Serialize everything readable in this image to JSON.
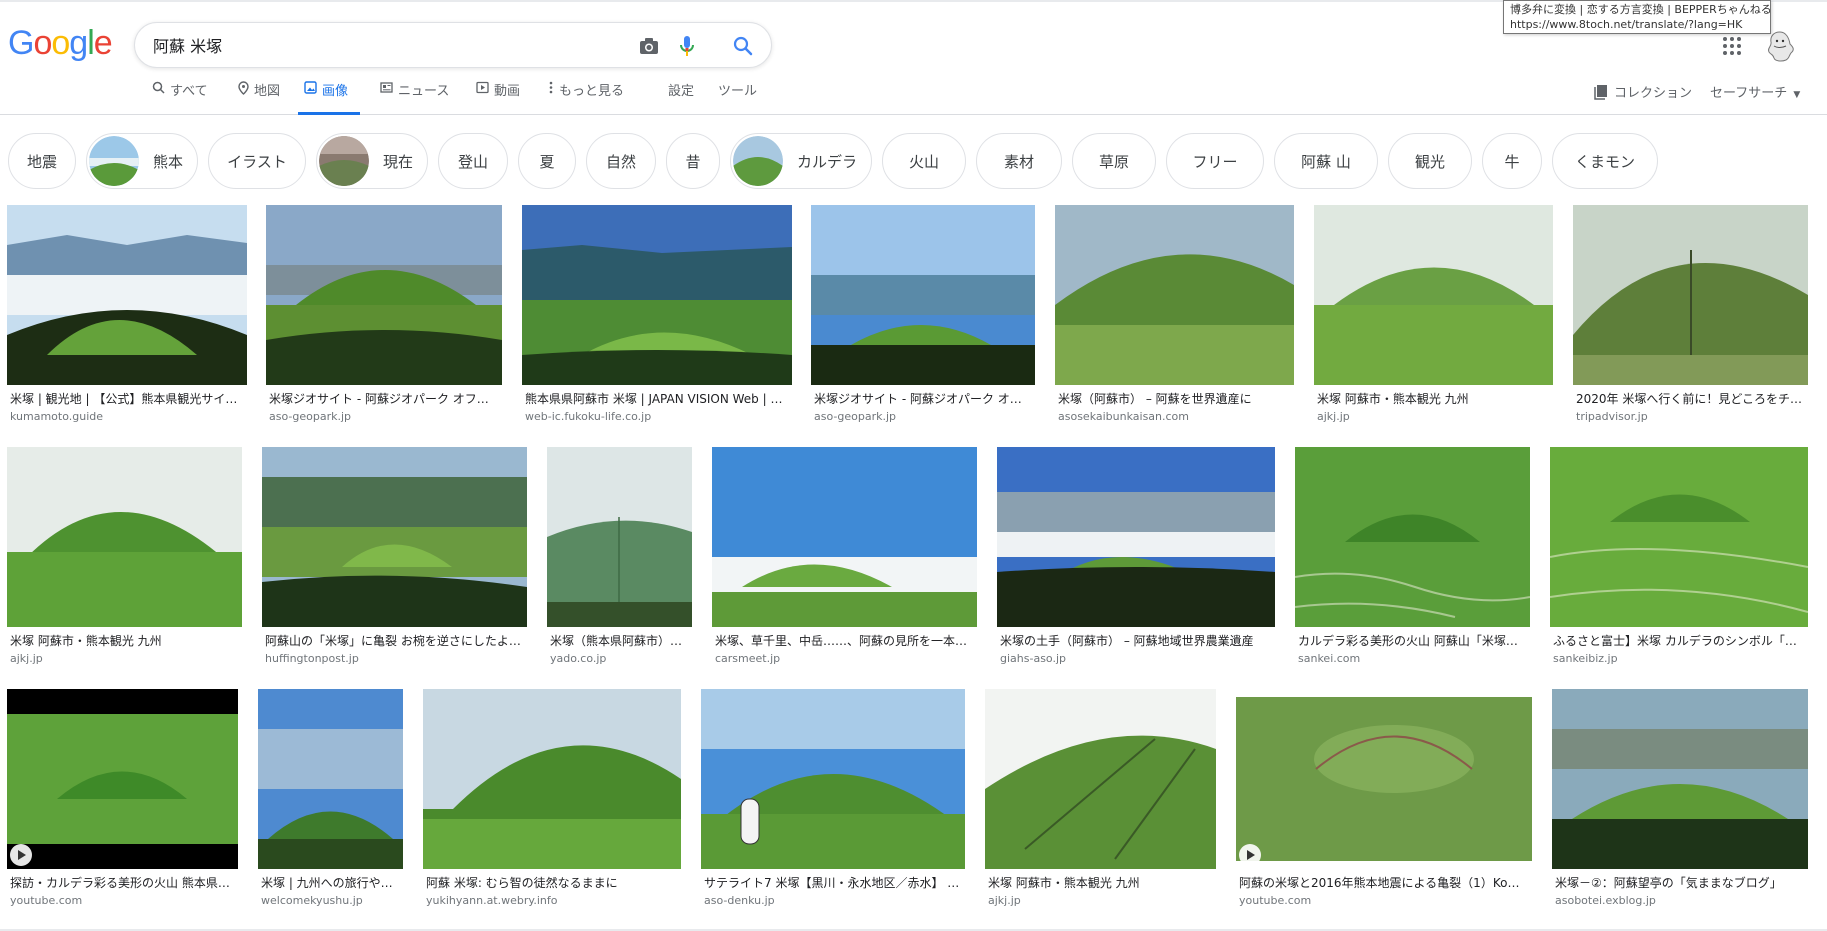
{
  "logo": {
    "letters": [
      "G",
      "o",
      "o",
      "g",
      "l",
      "e"
    ]
  },
  "search": {
    "query": "阿蘇 米塚"
  },
  "tooltip": {
    "line1": "博多弁に変換 | 恋する方言変換 | BEPPERちゃんねる",
    "line2": "https://www.8toch.net/translate/?lang=HK"
  },
  "nav": {
    "all": "すべて",
    "maps": "地図",
    "images": "画像",
    "news": "ニュース",
    "videos": "動画",
    "more": "もっと見る",
    "settings": "設定",
    "tools": "ツール"
  },
  "collections": "コレクション",
  "safesearch": "セーフサーチ",
  "chips": [
    "地震",
    "熊本",
    "イラスト",
    "現在",
    "登山",
    "夏",
    "自然",
    "昔",
    "カルデラ",
    "火山",
    "素材",
    "草原",
    "フリー",
    "阿蘇 山",
    "観光",
    "牛",
    "くまモン"
  ],
  "results": [
    {
      "title": "米塚 | 観光地 | 【公式】熊本県観光サイ…",
      "source": "kumamoto.guide"
    },
    {
      "title": "米塚ジオサイト - 阿蘇ジオパーク オフ…",
      "source": "aso-geopark.jp"
    },
    {
      "title": "熊本県県阿蘇市 米塚 | JAPAN VISION Web | フ…",
      "source": "web-ic.fukoku-life.co.jp"
    },
    {
      "title": "米塚ジオサイト - 阿蘇ジオパーク オ…",
      "source": "aso-geopark.jp"
    },
    {
      "title": "米塚（阿蘇市） – 阿蘇を世界遺産に",
      "source": "asosekaibunkaisan.com"
    },
    {
      "title": "米塚 阿蘇市・熊本観光 九州",
      "source": "ajkj.jp"
    },
    {
      "title": "2020年 米塚へ行く前に！見どころをチ…",
      "source": "tripadvisor.jp"
    },
    {
      "title": "米塚 阿蘇市・熊本観光 九州",
      "source": "ajkj.jp"
    },
    {
      "title": "阿蘇山の「米塚」に亀裂 お椀を逆さにしたよ…",
      "source": "huffingtonpost.jp"
    },
    {
      "title": "米塚（熊本県阿蘇市）…",
      "source": "yado.co.jp"
    },
    {
      "title": "米塚、草千里、中岳……、阿蘇の見所を一本に…",
      "source": "carsmeet.jp"
    },
    {
      "title": "米塚の土手（阿蘇市） – 阿蘇地域世界農業遺産",
      "source": "giahs-aso.jp"
    },
    {
      "title": "カルデラ彩る美形の火山 阿蘇山「米塚…",
      "source": "sankei.com"
    },
    {
      "title": "ふるさと富士】米塚 カルデラのシンボル「…",
      "source": "sankeibiz.jp"
    },
    {
      "title": "探訪・カルデラ彩る美形の火山 熊本県…",
      "source": "youtube.com"
    },
    {
      "title": "米塚 | 九州への旅行や…",
      "source": "welcomekyushu.jp"
    },
    {
      "title": "阿蘇 米塚: むら智の徒然なるままに",
      "source": "yukihyann.at.webry.info"
    },
    {
      "title": "サテライト7 米塚【黒川・永水地区／赤水】 …",
      "source": "aso-denku.jp"
    },
    {
      "title": "米塚 阿蘇市・熊本観光 九州",
      "source": "ajkj.jp"
    },
    {
      "title": "阿蘇の米塚と2016年熊本地震による亀裂（1）Kom…",
      "source": "youtube.com"
    },
    {
      "title": "米塚－②：阿蘇望亭の「気ままなブログ」",
      "source": "asobotei.exblog.jp"
    }
  ],
  "colors": {
    "accent": "#1a73e8",
    "logo_blue": "#4285f4",
    "logo_red": "#ea4335",
    "logo_yellow": "#fbbc05",
    "logo_green": "#34a853"
  }
}
